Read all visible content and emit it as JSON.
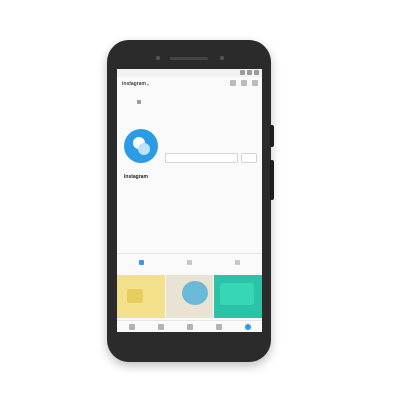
{
  "profile": {
    "username": "instagram",
    "display_name": "Instagram",
    "category": "",
    "stats": [
      {
        "value": "",
        "label": ""
      },
      {
        "value": "",
        "label": ""
      },
      {
        "value": "",
        "label": ""
      }
    ],
    "follow_label": "",
    "more_label": "",
    "bio_lines": [
      "",
      ""
    ],
    "bio_tag": "",
    "bio_link": "",
    "followed_by": "",
    "show_more": ""
  },
  "browser": {
    "url": ""
  },
  "colors": {
    "phone_body": "#2b2b2b",
    "avatar": "#2a9be4",
    "accent": "#3897f0",
    "post1": "#f3e08a",
    "post2": "#e9e3d4",
    "post3": "#2bc3a8"
  },
  "icons": {
    "top": [
      "add-icon",
      "heart-icon",
      "menu-icon"
    ],
    "view_tabs": [
      "grid-icon",
      "igtv-icon",
      "tagged-icon"
    ],
    "bottom_nav": [
      "home-icon",
      "search-icon",
      "add-post-icon",
      "activity-icon",
      "profile-icon"
    ]
  }
}
